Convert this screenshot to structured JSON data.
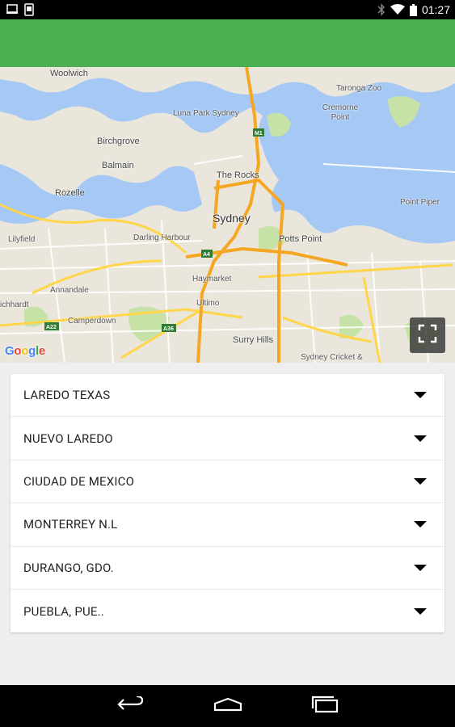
{
  "status_bar": {
    "time": "01:27",
    "icons": [
      "image-icon",
      "phone-icon",
      "bluetooth-icon",
      "wifi-icon",
      "battery-icon"
    ]
  },
  "toolbar": {
    "color": "#4caf50"
  },
  "map": {
    "labels": {
      "woolwich": "Woolwich",
      "taronga_zoo": "Taronga Zoo",
      "luna_park": "Luna Park Sydney",
      "cremorne_point": "Cremorne\nPoint",
      "birchgrove": "Birchgrove",
      "balmain": "Balmain",
      "the_rocks": "The Rocks",
      "rozelle": "Rozelle",
      "sydney": "Sydney",
      "point_piper": "Point Piper",
      "lilyfield": "Lilyfield",
      "darling_harbour": "Darling Harbour",
      "potts_point": "Potts Point",
      "haymarket": "Haymarket",
      "annandale": "Annandale",
      "ultimo": "Ultimo",
      "marrickville_cut": "ichhardt",
      "camperdown": "Camperdown",
      "surry_hills": "Surry Hills",
      "sydney_cricket": "Sydney Cricket &"
    },
    "road_badges": [
      "M1",
      "A4",
      "A22",
      "A36"
    ],
    "attribution": "Google",
    "colors": {
      "water": "#a5c8f5",
      "land": "#eae6dc",
      "park": "#c7e2a7",
      "road_major": "#f5a623",
      "road_minor": "#ffffff"
    }
  },
  "locations": [
    {
      "label": "LAREDO TEXAS"
    },
    {
      "label": "NUEVO LAREDO"
    },
    {
      "label": "CIUDAD DE MEXICO"
    },
    {
      "label": "MONTERREY N.L"
    },
    {
      "label": "DURANGO, GDO."
    },
    {
      "label": "PUEBLA, PUE.."
    }
  ],
  "nav_bar": {
    "buttons": [
      "back-icon",
      "home-icon",
      "recents-icon"
    ]
  }
}
